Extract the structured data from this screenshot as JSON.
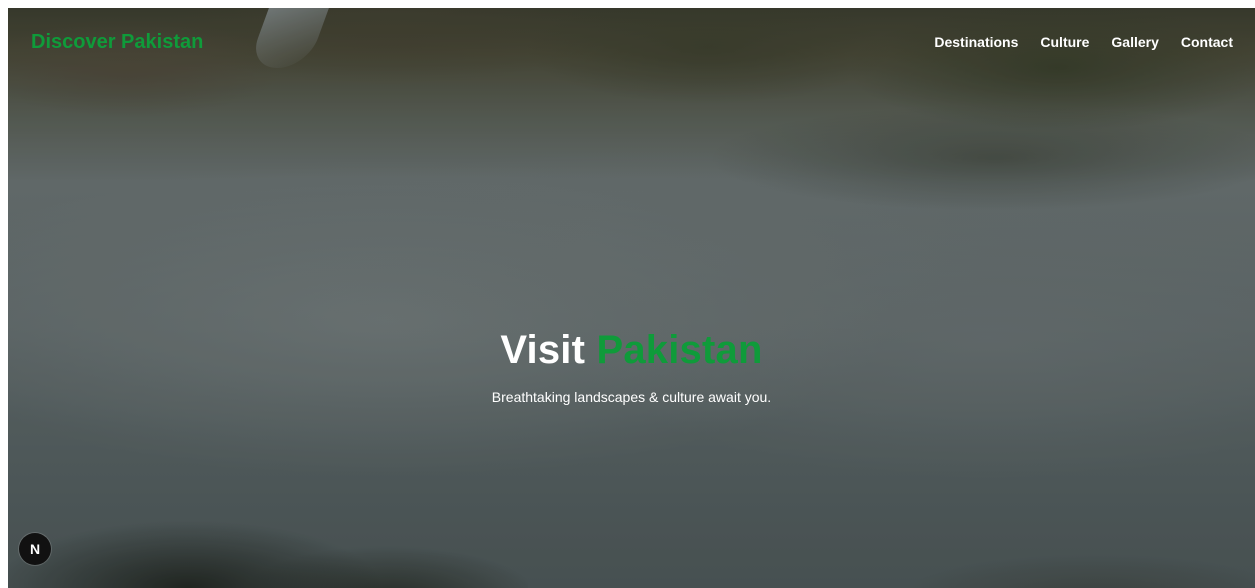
{
  "navbar": {
    "brand": "Discover Pakistan",
    "links": [
      {
        "label": "Destinations"
      },
      {
        "label": "Culture"
      },
      {
        "label": "Gallery"
      },
      {
        "label": "Contact"
      }
    ]
  },
  "hero": {
    "title_part1": "Visit ",
    "title_part2": "Pakistan",
    "subtitle": "Breathtaking landscapes & culture await you."
  },
  "badge": {
    "label": "N",
    "icon": "nextjs-icon"
  },
  "colors": {
    "brand_green": "#0f9b3a",
    "text_white": "#ffffff"
  }
}
